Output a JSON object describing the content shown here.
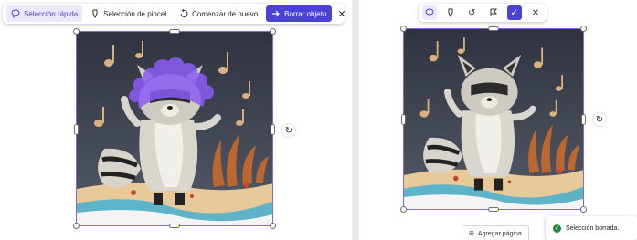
{
  "left_toolbar": {
    "quick_select": "Selección rápida",
    "brush_select": "Selección de pincel",
    "start_over": "Comenzar de nuevo",
    "erase_object": "Borrar objeto"
  },
  "right_panel": {
    "add_page": "Agregar página",
    "toast": "Selección borrada."
  },
  "colors": {
    "accent": "#4a41d6",
    "selection_overlay": "#8b5cf6",
    "success": "#1f8a3a"
  },
  "icons": [
    "lasso-icon",
    "brush-icon",
    "undo-icon",
    "arrow-right-icon",
    "close-icon",
    "rotate-icon",
    "flag-icon",
    "check-icon",
    "add-page-icon"
  ]
}
